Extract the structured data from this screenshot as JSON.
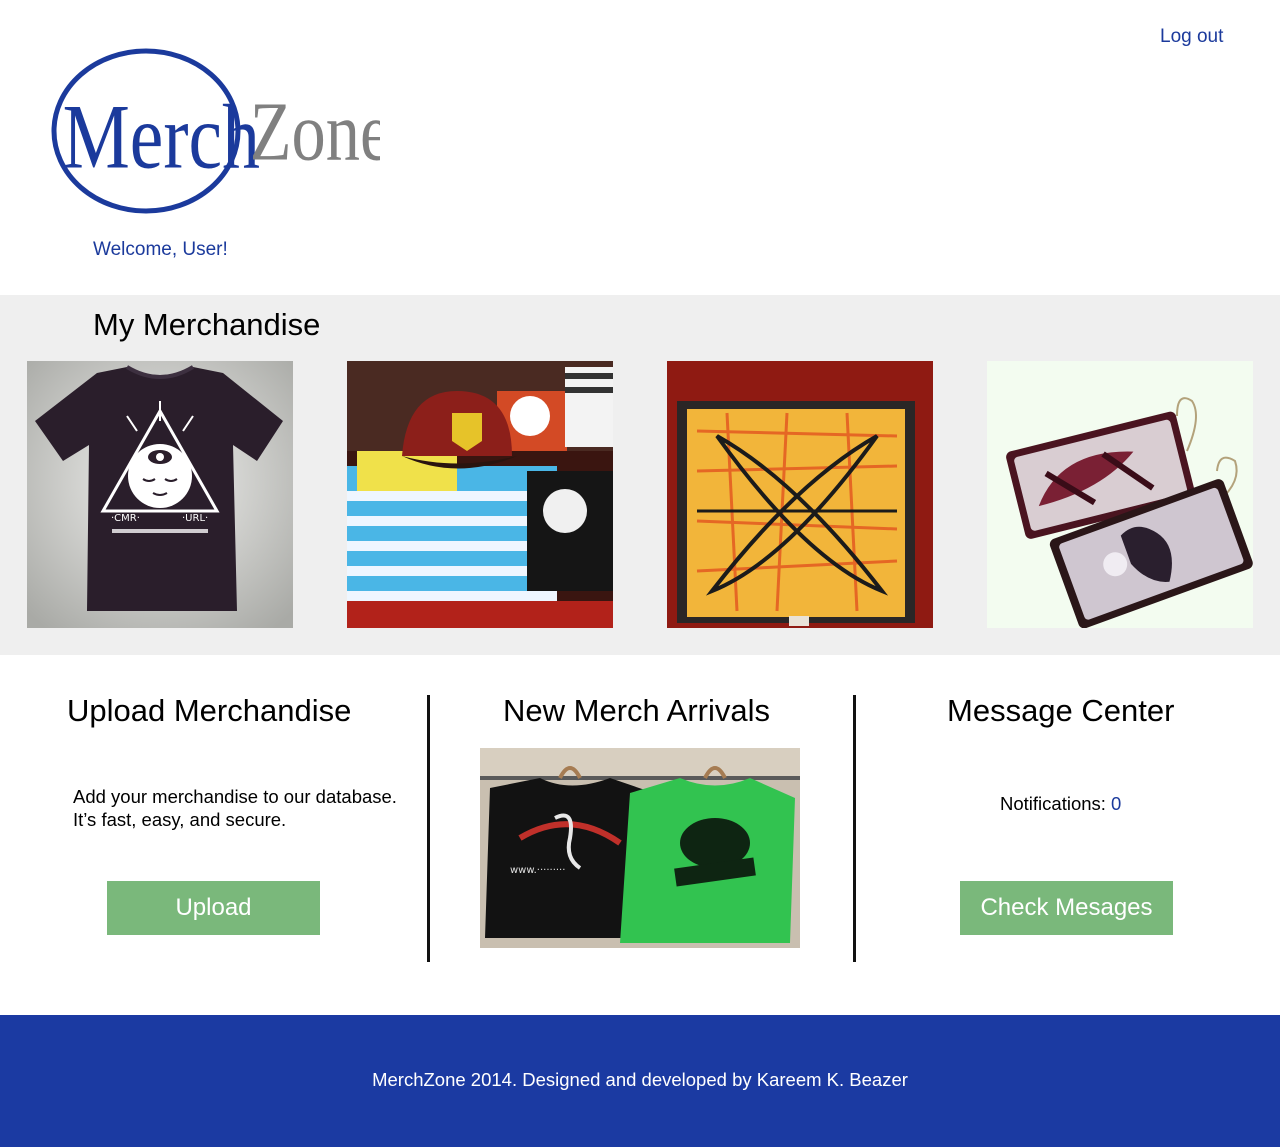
{
  "header": {
    "logout_label": "Log out",
    "logo": {
      "text_part1": "Merch",
      "text_part2": "Zone",
      "ring_color": "#1b3a9c",
      "zone_color": "#808080"
    },
    "welcome": "Welcome, User!"
  },
  "merchandise": {
    "title": "My Merchandise",
    "items": [
      {
        "name": "T-shirt with eye graphic",
        "icon": "tshirt-photo"
      },
      {
        "name": "Hat and shirts collection",
        "icon": "hat-shirts-photo"
      },
      {
        "name": "Surfboard painting",
        "icon": "painting-photo"
      },
      {
        "name": "Earrings",
        "icon": "earrings-photo"
      }
    ]
  },
  "upload": {
    "title": "Upload Merchandise",
    "description": "Add your merchandise to our database. It’s fast, easy, and secure.",
    "button_label": "Upload"
  },
  "arrivals": {
    "title": "New Merch Arrivals",
    "image": "new-shirts-photo"
  },
  "messages": {
    "title": "Message Center",
    "notifications_label": "Notifications:",
    "notifications_count": "0",
    "button_label": "Check Mesages"
  },
  "footer": {
    "text": "MerchZone 2014. Designed and developed by Kareem K. Beazer"
  },
  "colors": {
    "brand_blue": "#1b3a9c",
    "band_gray": "#efefef",
    "button_green": "#7ab87b",
    "footer_blue": "#1b3aa2"
  }
}
